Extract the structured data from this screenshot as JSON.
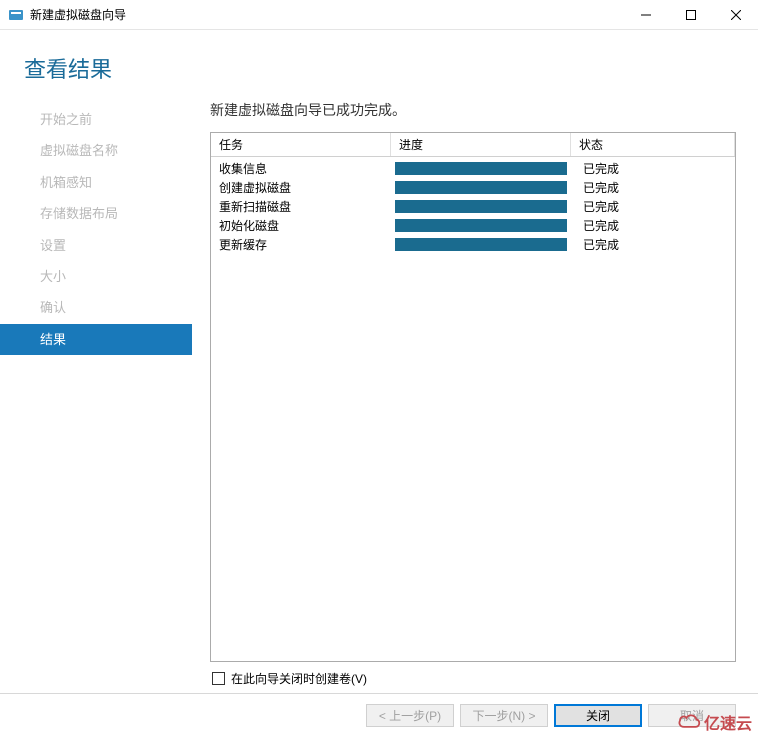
{
  "window": {
    "title": "新建虚拟磁盘向导"
  },
  "page": {
    "title": "查看结果",
    "completion_message": "新建虚拟磁盘向导已成功完成。"
  },
  "sidebar": {
    "items": [
      {
        "label": "开始之前",
        "active": false
      },
      {
        "label": "虚拟磁盘名称",
        "active": false
      },
      {
        "label": "机箱感知",
        "active": false
      },
      {
        "label": "存储数据布局",
        "active": false
      },
      {
        "label": "设置",
        "active": false
      },
      {
        "label": "大小",
        "active": false
      },
      {
        "label": "确认",
        "active": false
      },
      {
        "label": "结果",
        "active": true
      }
    ]
  },
  "results": {
    "headers": {
      "task": "任务",
      "progress": "进度",
      "status": "状态"
    },
    "rows": [
      {
        "task": "收集信息",
        "status": "已完成"
      },
      {
        "task": "创建虚拟磁盘",
        "status": "已完成"
      },
      {
        "task": "重新扫描磁盘",
        "status": "已完成"
      },
      {
        "task": "初始化磁盘",
        "status": "已完成"
      },
      {
        "task": "更新缓存",
        "status": "已完成"
      }
    ]
  },
  "checkbox": {
    "label": "在此向导关闭时创建卷(V)"
  },
  "footer": {
    "previous": "< 上一步(P)",
    "next": "下一步(N) >",
    "close": "关闭",
    "cancel": "取消"
  },
  "watermark": {
    "text": "亿速云"
  }
}
